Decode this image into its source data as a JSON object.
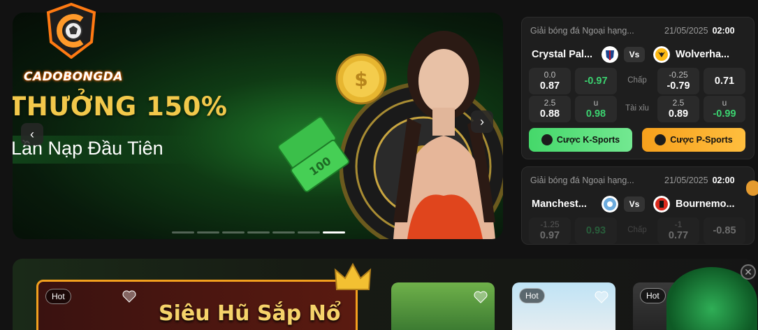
{
  "logo": {
    "brand": "CADOBONGDA"
  },
  "banner": {
    "headline": "THƯỞNG 150%",
    "subline": "Lần Nạp Đầu Tiên",
    "prev_icon": "chevron-left-icon",
    "next_icon": "chevron-right-icon",
    "slides_total": 7,
    "active_slide": 7,
    "prev_label": "‹",
    "next_label": "›"
  },
  "matches": [
    {
      "league": "Giải bóng đá Ngoại hạng...",
      "date": "21/05/2025",
      "time": "02:00",
      "home": "Crystal Pal...",
      "away": "Wolverha...",
      "vs": "Vs",
      "handicap": {
        "label": "Chấp",
        "home_line": "0.0",
        "home_odd": "0.87",
        "home_odd2": "-0.97",
        "away_line": "-0.25",
        "away_odd": "-0.79",
        "away_odd2": "0.71"
      },
      "overunder": {
        "label": "Tài xỉu",
        "line": "2.5",
        "over_odd": "0.88",
        "u_label": "u",
        "u_odd": "0.98",
        "line2": "2.5",
        "over_odd2": "0.89",
        "u_label2": "u",
        "u_odd2": "-0.99"
      },
      "btn_k": "Cược K-Sports",
      "btn_p": "Cược P-Sports"
    },
    {
      "league": "Giải bóng đá Ngoại hạng...",
      "date": "21/05/2025",
      "time": "02:00",
      "home": "Manchest...",
      "away": "Bournemo...",
      "vs": "Vs",
      "handicap": {
        "label": "Chấp",
        "home_line": "-1.25",
        "home_odd": "0.97",
        "home_odd2": "0.93",
        "away_line": "-1",
        "away_odd": "0.77",
        "away_odd2": "-0.85"
      }
    }
  ],
  "games": {
    "jackpot_title": "Siêu Hũ Sắp Nổ",
    "hot_label": "Hot",
    "close_label": "✕"
  },
  "colors": {
    "accent_green": "#3bd16f",
    "accent_orange": "#f6a01c",
    "headline_gold": "#f2c84b"
  }
}
